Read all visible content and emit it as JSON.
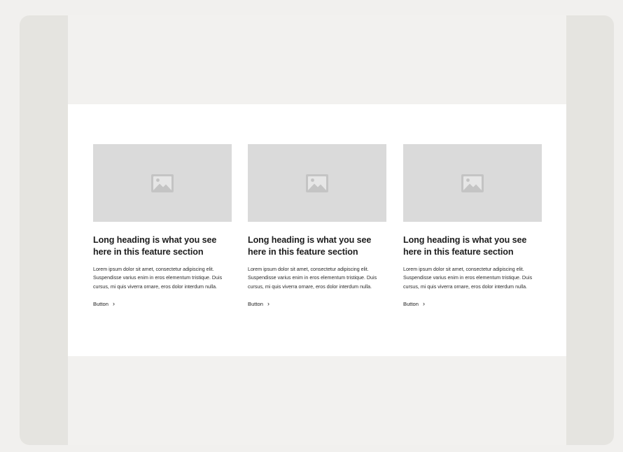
{
  "feature_section": {
    "cards": [
      {
        "heading": "Long heading is what you see here in this feature section",
        "body": "Lorem ipsum dolor sit amet, consectetur adipiscing elit. Suspendisse varius enim in eros elementum tristique. Duis cursus, mi quis viverra ornare, eros dolor interdum nulla.",
        "button_label": "Button",
        "button_icon": "chevron-right-icon",
        "image_icon": "image-placeholder-icon"
      },
      {
        "heading": "Long heading is what you see here in this feature section",
        "body": "Lorem ipsum dolor sit amet, consectetur adipiscing elit. Suspendisse varius enim in eros elementum tristique. Duis cursus, mi quis viverra ornare, eros dolor interdum nulla.",
        "button_label": "Button",
        "button_icon": "chevron-right-icon",
        "image_icon": "image-placeholder-icon"
      },
      {
        "heading": "Long heading is what you see here in this feature section",
        "body": "Lorem ipsum dolor sit amet, consectetur adipiscing elit. Suspendisse varius enim in eros elementum tristique. Duis cursus, mi quis viverra ornare, eros dolor interdum nulla.",
        "button_label": "Button",
        "button_icon": "chevron-right-icon",
        "image_icon": "image-placeholder-icon"
      }
    ]
  },
  "colors": {
    "page_background": "#f1f0ee",
    "frame_background": "#e5e4e0",
    "canvas_background": "#f2f1ef",
    "section_background": "#ffffff",
    "image_placeholder": "#dadada",
    "text": "#1d1d1d"
  }
}
